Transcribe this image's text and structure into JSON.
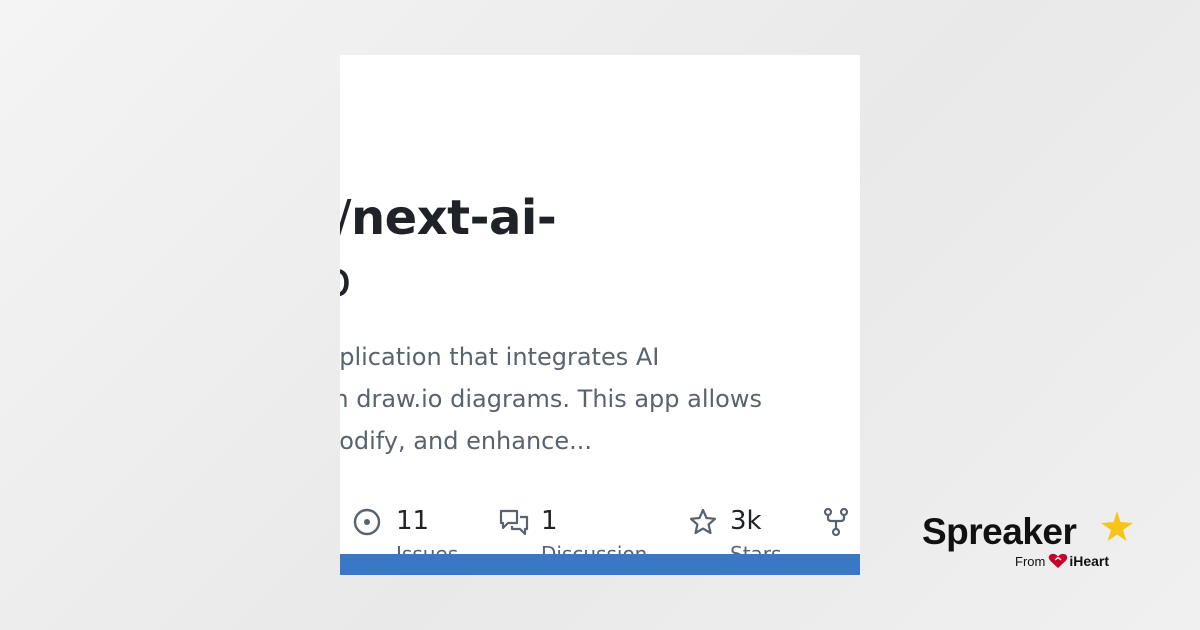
{
  "repo": {
    "owner_fragment": "Jiang/",
    "name_fragment": "next-ai-",
    "name_line2": "o"
  },
  "description": {
    "lines": [
      "pplication that integrates AI",
      "th draw.io diagrams. This app allows",
      "nodify, and enhance..."
    ]
  },
  "stats": {
    "issues": {
      "count": "11",
      "label": "Issues"
    },
    "discussions": {
      "count": "1",
      "label": "Discussion"
    },
    "stars": {
      "count": "3k",
      "label": "Stars"
    }
  },
  "brand": {
    "name": "Spreaker",
    "from_label": "From",
    "partner": "iHeart"
  },
  "colors": {
    "accent_bar": "#3878c7",
    "star": "#f5c518",
    "heart": "#c6002b",
    "text_primary": "#1f2328",
    "text_muted": "#59636e"
  }
}
